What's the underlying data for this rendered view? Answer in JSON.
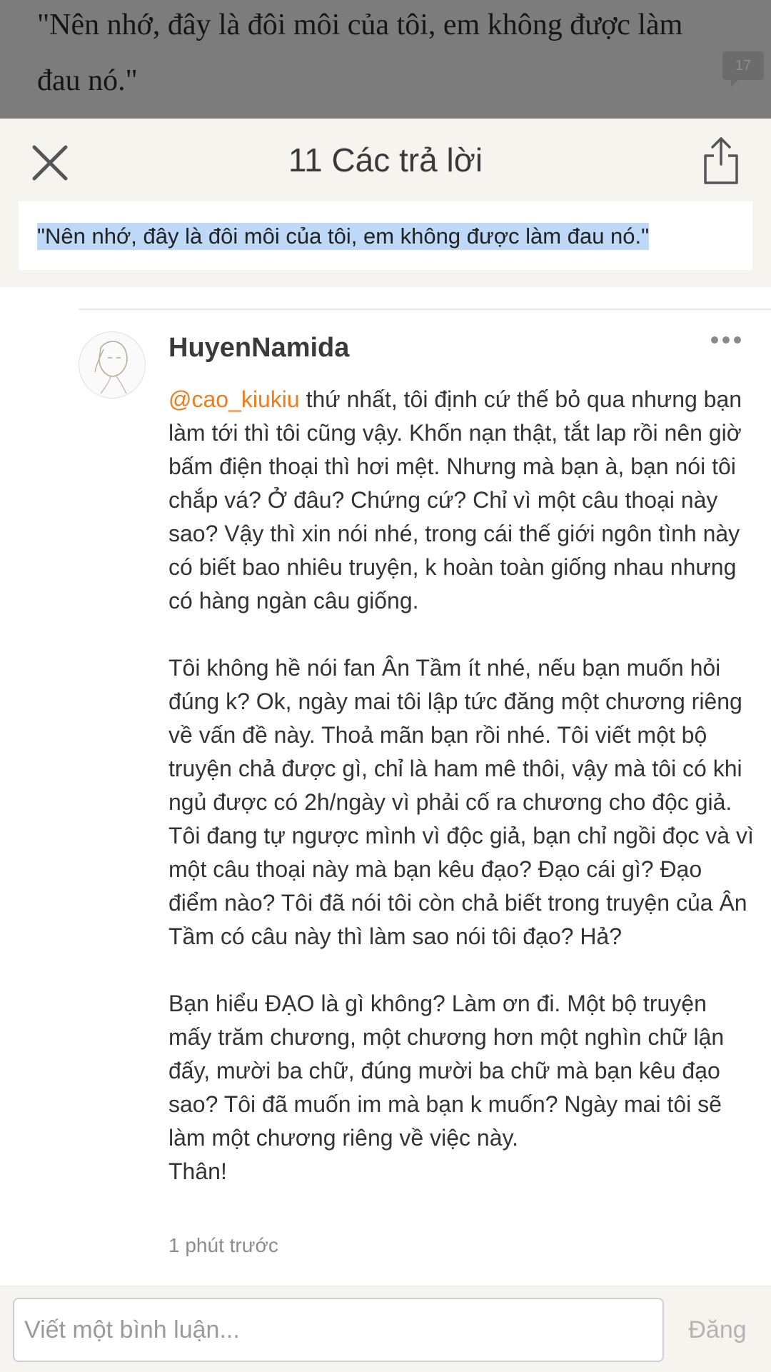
{
  "story": {
    "quote_text": "\"Nên nhớ, đây là đôi môi của tôi, em không được làm đau nó.\"",
    "comment_count": "17"
  },
  "header": {
    "title": "11 Các trả lời",
    "close_icon": "close-icon",
    "share_icon": "share-icon"
  },
  "selected_quote": "\"Nên nhớ, đây là đôi môi của tôi, em không được làm đau nó.\"",
  "comment": {
    "username": "HuyenNamida",
    "mention": "@cao_kiukiu",
    "paragraphs": [
      " thứ nhất, tôi định cứ thế bỏ qua nhưng bạn làm tới thì tôi cũng vậy. Khốn nạn thật, tắt lap rồi nên giờ bấm điện thoại thì hơi mệt. Nhưng mà bạn à, bạn nói tôi chắp vá? Ở đâu? Chứng cứ? Chỉ vì một câu thoại này sao? Vậy thì xin nói nhé, trong cái thế giới ngôn tình này có biết bao nhiêu truyện, k hoàn toàn giống nhau nhưng có hàng ngàn câu giống.",
      "Tôi không hề nói fan Ân Tầm ít nhé, nếu bạn muốn hỏi đúng k? Ok, ngày mai tôi lập tức đăng một chương riêng về vấn đề này. Thoả mãn bạn rồi nhé. Tôi viết một bộ truyện chả được gì, chỉ là ham mê thôi, vậy mà tôi có khi ngủ được có 2h/ngày vì phải cố ra chương cho độc giả. Tôi đang tự ngược mình vì độc giả, bạn chỉ ngồi đọc và vì một câu thoại này mà bạn kêu đạo? Đạo cái gì? Đạo điểm nào? Tôi đã nói tôi còn chả biết trong truyện của Ân Tầm có câu này thì làm sao nói tôi đạo? Hả?",
      "Bạn hiểu ĐẠO là gì không? Làm ơn đi. Một bộ truyện mấy trăm chương, một chương hơn một nghìn chữ lận đấy, mười ba chữ, đúng mười ba chữ mà bạn kêu đạo sao? Tôi đã muốn im mà bạn k muốn? Ngày mai tôi sẽ làm một chương riêng về việc này.",
      "Thân!"
    ],
    "timestamp": "1 phút trước"
  },
  "compose": {
    "placeholder": "Viết một bình luận...",
    "post_label": "Đăng"
  },
  "colors": {
    "mention": "#f07b1a",
    "selection": "#bed9f7",
    "header_bg": "#f5f4ef"
  }
}
